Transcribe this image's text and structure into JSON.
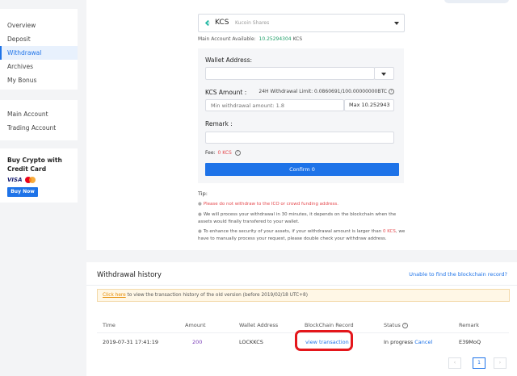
{
  "sidebar": {
    "nav": [
      {
        "label": "Overview"
      },
      {
        "label": "Deposit"
      },
      {
        "label": "Withdrawal"
      },
      {
        "label": "Archives"
      },
      {
        "label": "My Bonus"
      }
    ],
    "accounts": [
      {
        "label": "Main Account"
      },
      {
        "label": "Trading Account"
      }
    ],
    "buy": {
      "title_line1": "Buy Crypto with",
      "title_line2": "Credit Card",
      "visa": "VISA",
      "button": "Buy Now"
    }
  },
  "coin": {
    "symbol": "KCS",
    "name": "Kucoin Shares"
  },
  "available": {
    "label": "Main Account Available:",
    "amount": "10.25294304",
    "unit": "KCS"
  },
  "form": {
    "address_label": "Wallet Address:",
    "amount_label": "KCS Amount :",
    "limit_text": "24H Withdrawal Limit: 0.0860691/100.00000000BTC",
    "amount_placeholder": "Min withdrawal amount: 1.8",
    "max_text": "Max 10.252943",
    "remark_label": "Remark :",
    "fee_label": "Fee:",
    "fee_value": "0 KCS",
    "confirm": "Confirm 0"
  },
  "tips": {
    "title": "Tip:",
    "items": [
      "Please do not withdraw to the ICO or crowd funding address.",
      "We will process your withdrawal in 30 minutes, it depends on the blockchain when the",
      "assets would finally transfered to your wallet.",
      "To enhance the security of your assets, if your withdrawal amount is larger than",
      "0 KCS",
      ", we",
      "have to manually process your request, please double check your withdraw address."
    ]
  },
  "history": {
    "title": "Withdrawal history",
    "blockchain_help": "Unable to find the blockchain record?",
    "old_link": "Click here",
    "old_text": " to view the transaction history of the old version (before 2019/02/18 UTC+8)",
    "columns": [
      "Time",
      "Amount",
      "Wallet Address",
      "BlockChain Record",
      "Status",
      "Remark"
    ],
    "rows": [
      {
        "time": "2019-07-31 17:41:19",
        "amount": "200",
        "address": "LOCKKCS",
        "record": "view transaction",
        "status": "In progress",
        "action": "Cancel",
        "remark": "E39MoQ"
      }
    ],
    "pager": {
      "prev": "‹",
      "current": "1",
      "next": "›"
    }
  },
  "colors": {
    "accent": "#1e73e8",
    "highlight": "#e4161b",
    "available_green": "#22a06b",
    "warning_red": "#e5484d"
  }
}
